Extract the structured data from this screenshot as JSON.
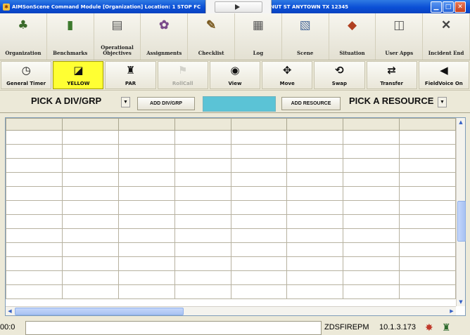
{
  "window": {
    "title_left": "AIMSonScene Command Module [Organization] Location: 1 STOP FC",
    "title_right": "NUT ST ANYTOWN TX 12345"
  },
  "toolbar_main": [
    {
      "label": "Organization",
      "icon": "org-chart-icon",
      "glyph": "♣",
      "color": "#3a6a2a"
    },
    {
      "label": "Benchmarks",
      "icon": "benchmark-chart-icon",
      "glyph": "▮",
      "color": "#3d7a2e"
    },
    {
      "label": "Operational Objectives",
      "icon": "objectives-icon",
      "glyph": "▤",
      "color": "#555"
    },
    {
      "label": "Assignments",
      "icon": "assignments-icon",
      "glyph": "✿",
      "color": "#7a4a8a"
    },
    {
      "label": "Checklist",
      "icon": "checklist-icon",
      "glyph": "✎",
      "color": "#7a5a20"
    },
    {
      "label": "Log",
      "icon": "log-printer-icon",
      "glyph": "▦",
      "color": "#555"
    },
    {
      "label": "Scene",
      "icon": "scene-icon",
      "glyph": "▧",
      "color": "#4a6a9a"
    },
    {
      "label": "Situation",
      "icon": "situation-icon",
      "glyph": "◆",
      "color": "#b04020"
    },
    {
      "label": "User Apps",
      "icon": "user-apps-icon",
      "glyph": "◫",
      "color": "#555"
    },
    {
      "label": "Incident End",
      "icon": "incident-end-icon",
      "glyph": "✕",
      "color": "#444"
    }
  ],
  "toolbar_secondary": [
    {
      "label": "General Timer",
      "icon": "timer-clock-icon",
      "glyph": "◷",
      "style": "normal"
    },
    {
      "label": "YELLOW",
      "icon": "alert-level-icon",
      "glyph": "◪",
      "style": "yellow"
    },
    {
      "label": "PAR",
      "icon": "par-icon",
      "glyph": "♜",
      "style": "normal"
    },
    {
      "label": "RollCall",
      "icon": "rollcall-icon",
      "glyph": "⚑",
      "style": "disabled"
    },
    {
      "label": "View",
      "icon": "eye-icon",
      "glyph": "◉",
      "style": "normal"
    },
    {
      "label": "Move",
      "icon": "move-arrows-icon",
      "glyph": "✥",
      "style": "normal"
    },
    {
      "label": "Swap",
      "icon": "swap-icon",
      "glyph": "⟲",
      "style": "normal"
    },
    {
      "label": "Transfer",
      "icon": "transfer-icon",
      "glyph": "⇄",
      "style": "normal"
    },
    {
      "label": "FieldVoice On",
      "icon": "speaker-icon",
      "glyph": "◀",
      "style": "normal"
    }
  ],
  "selection_row": {
    "divgrp_value": "PICK A DIV/GRP",
    "add_divgrp_label": "ADD DIV/GRP",
    "add_resource_label": "ADD RESOURCE",
    "resource_value": "PICK A RESOURCE"
  },
  "grid": {
    "columns": 8,
    "rows": 13
  },
  "statusbar": {
    "time_fragment": "00:0",
    "station": "ZDSFIREPM",
    "ip": "10.1.3.173"
  }
}
